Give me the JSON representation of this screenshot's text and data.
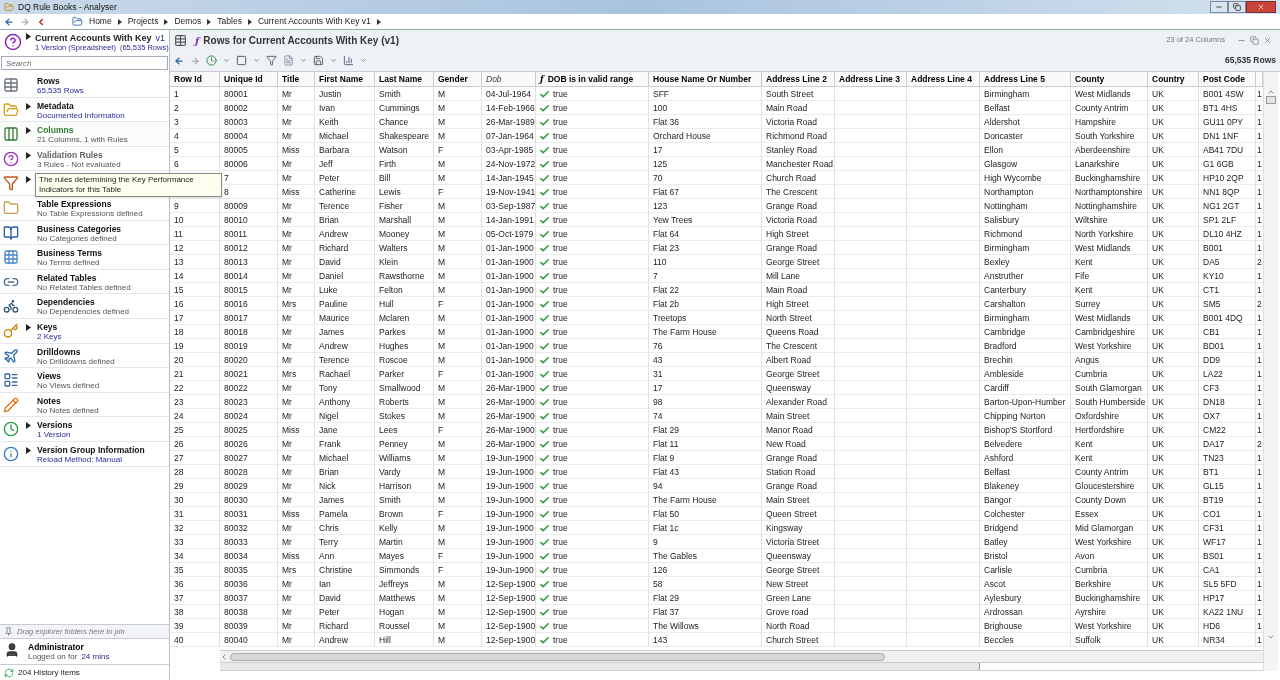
{
  "window": {
    "title": "DQ Rule Books - Analyser"
  },
  "breadcrumbs": [
    "Home",
    "Projects",
    "Demos",
    "Tables",
    "Current Accounts With Key v1"
  ],
  "sidebar": {
    "title": "Current Accounts With Key",
    "version_tag": "v1",
    "subtitle": "1 Version (Spreadsheet)",
    "row_count": "(65,535 Rows)",
    "search": {
      "placeholder": "Search"
    },
    "items": [
      {
        "title": "Rows",
        "sub": "65,535 Rows",
        "has_children": false,
        "hovered": false,
        "dimmed": false,
        "sub_link": true
      },
      {
        "title": "Metadata",
        "sub": "Documented Information",
        "has_children": true,
        "hovered": false,
        "dimmed": false,
        "sub_link": true
      },
      {
        "title": "Columns",
        "sub": "21 Columns, 1 with Rules",
        "has_children": true,
        "hovered": true,
        "dimmed": false,
        "sub_link": false
      },
      {
        "title": "Validation Rules",
        "sub": "3 Rules - Not evaluated",
        "has_children": true,
        "hovered": false,
        "dimmed": true,
        "sub_link": false
      },
      {
        "has_children": true
      },
      {
        "title": "Table Expressions",
        "sub": "No Table Expressions defined",
        "has_children": false,
        "hovered": false,
        "dimmed": false,
        "sub_link": false
      },
      {
        "title": "Business Categories",
        "sub": "No Categories defined",
        "has_children": false,
        "hovered": false,
        "dimmed": false,
        "sub_link": false
      },
      {
        "title": "Business Terms",
        "sub": "No Terms defined",
        "has_children": false,
        "hovered": false,
        "dimmed": false,
        "sub_link": false
      },
      {
        "title": "Related Tables",
        "sub": "No Related Tables defined",
        "has_children": false,
        "hovered": false,
        "dimmed": false,
        "sub_link": false
      },
      {
        "title": "Dependencies",
        "sub": "No Dependencies defined",
        "has_children": false,
        "hovered": false,
        "dimmed": false,
        "sub_link": false
      },
      {
        "title": "Keys",
        "sub": "2 Keys",
        "has_children": true,
        "hovered": false,
        "dimmed": false,
        "sub_link": true
      },
      {
        "title": "Drilldowns",
        "sub": "No Drilldowns defined",
        "has_children": false,
        "hovered": false,
        "dimmed": false,
        "sub_link": false
      },
      {
        "title": "Views",
        "sub": "No Views defined",
        "has_children": false,
        "hovered": false,
        "dimmed": false,
        "sub_link": false
      },
      {
        "title": "Notes",
        "sub": "No Notes defined",
        "has_children": false,
        "hovered": false,
        "dimmed": false,
        "sub_link": false
      },
      {
        "title": "Versions",
        "sub": "1 Version",
        "has_children": true,
        "hovered": false,
        "dimmed": false,
        "sub_link": true
      },
      {
        "title": "Version Group Information",
        "sub": "Reload Method: Manual",
        "has_children": true,
        "hovered": false,
        "dimmed": false,
        "sub_link": true
      }
    ],
    "pin_hint": "Drag explorer folders here to pin",
    "user": {
      "name": "Administrator",
      "status": "Logged on for",
      "duration": "24 mins"
    },
    "history": "204 History items"
  },
  "tooltip": "The rules determining the Key Performance Indicators for this Table",
  "panel": {
    "title_prefix": "ƒ",
    "title": "Rows for Current Accounts With Key (v1)",
    "columns_info": "23 of 24 Columns",
    "rows_info": "65,535 Rows"
  },
  "table": {
    "columns": [
      {
        "label": "Row Id",
        "kind": "data"
      },
      {
        "label": "Unique Id",
        "kind": "data"
      },
      {
        "label": "Title",
        "kind": "data"
      },
      {
        "label": "First Name",
        "kind": "data"
      },
      {
        "label": "Last Name",
        "kind": "data"
      },
      {
        "label": "Gender",
        "kind": "data"
      },
      {
        "label": "Dob",
        "kind": "lookup"
      },
      {
        "label": "DOB is in valid range",
        "kind": "rule",
        "prefix": "ƒ"
      },
      {
        "label": "House Name Or Number",
        "kind": "data"
      },
      {
        "label": "Address Line 2",
        "kind": "data"
      },
      {
        "label": "Address Line 3",
        "kind": "data"
      },
      {
        "label": "Address Line 4",
        "kind": "data"
      },
      {
        "label": "Address Line 5",
        "kind": "data"
      },
      {
        "label": "County",
        "kind": "data"
      },
      {
        "label": "Country",
        "kind": "data"
      },
      {
        "label": "Post Code",
        "kind": "data"
      },
      {
        "kind": "data"
      }
    ],
    "rows": [
      [
        "1",
        "80001",
        "Mr",
        "Justin",
        "Smith",
        "M",
        "04-Jul-1964",
        "true",
        "SFF",
        "South Street",
        null,
        null,
        "Birmingham",
        "West Midlands",
        "UK",
        "B001  4SW",
        "1"
      ],
      [
        "2",
        "80002",
        "Mr",
        "Ivan",
        "Cummings",
        "M",
        "14-Feb-1966",
        "true",
        "100",
        "Main Road",
        null,
        null,
        "Belfast",
        "County Antrim",
        "UK",
        "BT1 4HS",
        "1"
      ],
      [
        "3",
        "80003",
        "Mr",
        "Keith",
        "Chance",
        "M",
        "26-Mar-1989",
        "true",
        "Flat 36",
        "Victoria Road",
        null,
        null,
        "Aldershot",
        "Hampshire",
        "UK",
        "GU11 0PY",
        "1"
      ],
      [
        "4",
        "80004",
        "Mr",
        "Michael",
        "Shakespeare",
        "M",
        "07-Jan-1964",
        "true",
        "Orchard House",
        "Richmond Road",
        null,
        null,
        "Doncaster",
        "South Yorkshire",
        "UK",
        "DN1 1NF",
        "1"
      ],
      [
        "5",
        "80005",
        "Miss",
        "Barbara",
        "Watson",
        "F",
        "03-Apr-1985",
        "true",
        "17",
        "Stanley Road",
        null,
        null,
        "Ellon",
        "Aberdeenshire",
        "UK",
        "AB41 7DU",
        "1"
      ],
      [
        "6",
        "80006",
        "Mr",
        "Jeff",
        "Firth",
        "M",
        "24-Nov-1972",
        "true",
        "125",
        "Manchester Road",
        null,
        null,
        "Glasgow",
        "Lanarkshire",
        "UK",
        "G1 6GB",
        "1"
      ],
      [
        null,
        "7",
        "Mr",
        "Peter",
        "Bill",
        "M",
        "14-Jan-1945",
        "true",
        "70",
        "Church Road",
        null,
        null,
        "High Wycombe",
        "Buckinghamshire",
        "UK",
        "HP10 2QP",
        "1"
      ],
      [
        null,
        "8",
        "Miss",
        "Catherine",
        "Lewis",
        "F",
        "19-Nov-1941",
        "true",
        "Flat 67",
        "The Crescent",
        null,
        null,
        "Northampton",
        "Northamptonshire",
        "UK",
        "NN1 8QP",
        "1"
      ],
      [
        "9",
        "80009",
        "Mr",
        "Terence",
        "Fisher",
        "M",
        "03-Sep-1987",
        "true",
        "123",
        "Grange Road",
        null,
        null,
        "Nottingham",
        "Nottinghamshire",
        "UK",
        "NG1 2GT",
        "1"
      ],
      [
        "10",
        "80010",
        "Mr",
        "Brian",
        "Marshall",
        "M",
        "14-Jan-1991",
        "true",
        "Yew Trees",
        "Victoria Road",
        null,
        null,
        "Salisbury",
        "Wiltshire",
        "UK",
        "SP1 2LF",
        "1"
      ],
      [
        "11",
        "80011",
        "Mr",
        "Andrew",
        "Mooney",
        "M",
        "05-Oct-1979",
        "true",
        "Flat 64",
        "High Street",
        null,
        null,
        "Richmond",
        "North Yorkshire",
        "UK",
        "DL10 4HZ",
        "1"
      ],
      [
        "12",
        "80012",
        "Mr",
        "Richard",
        "Walters",
        "M",
        "01-Jan-1900",
        "true",
        "Flat 23",
        "Grange Road",
        null,
        null,
        "Birmingham",
        "West Midlands",
        "UK",
        "B001",
        "1"
      ],
      [
        "13",
        "80013",
        "Mr",
        "David",
        "Klein",
        "M",
        "01-Jan-1900",
        "true",
        "110",
        "George Street",
        null,
        null,
        "Bexley",
        "Kent",
        "UK",
        "DA5",
        "2"
      ],
      [
        "14",
        "80014",
        "Mr",
        "Daniel",
        "Rawsthorne",
        "M",
        "01-Jan-1900",
        "true",
        "7",
        "Mill Lane",
        null,
        null,
        "Anstruther",
        "Fife",
        "UK",
        "KY10",
        "1"
      ],
      [
        "15",
        "80015",
        "Mr",
        "Luke",
        "Felton",
        "M",
        "01-Jan-1900",
        "true",
        "Flat 22",
        "Main Road",
        null,
        null,
        "Canterbury",
        "Kent",
        "UK",
        "CT1",
        "1"
      ],
      [
        "16",
        "80016",
        "Mrs",
        "Pauline",
        "Hull",
        "F",
        "01-Jan-1900",
        "true",
        "Flat 2b",
        "High Street",
        null,
        null,
        "Carshalton",
        "Surrey",
        "UK",
        "SM5",
        "2"
      ],
      [
        "17",
        "80017",
        "Mr",
        "Maurice",
        "Mclaren",
        "M",
        "01-Jan-1900",
        "true",
        "Treetops",
        "North Street",
        null,
        null,
        "Birmingham",
        "West Midlands",
        "UK",
        "B001  4DQ",
        "1"
      ],
      [
        "18",
        "80018",
        "Mr",
        "James",
        "Parkes",
        "M",
        "01-Jan-1900",
        "true",
        "The Farm House",
        "Queens Road",
        null,
        null,
        "Cambridge",
        "Cambridgeshire",
        "UK",
        "CB1",
        "1"
      ],
      [
        "19",
        "80019",
        "Mr",
        "Andrew",
        "Hughes",
        "M",
        "01-Jan-1900",
        "true",
        "76",
        "The Crescent",
        null,
        null,
        "Bradford",
        "West Yorkshire",
        "UK",
        "BD01",
        "1"
      ],
      [
        "20",
        "80020",
        "Mr",
        "Terence",
        "Roscoe",
        "M",
        "01-Jan-1900",
        "true",
        "43",
        "Albert Road",
        null,
        null,
        "Brechin",
        "Angus",
        "UK",
        "DD9",
        "1"
      ],
      [
        "21",
        "80021",
        "Mrs",
        "Rachael",
        "Parker",
        "F",
        "01-Jan-1900",
        "true",
        "31",
        "George Street",
        null,
        null,
        "Ambleside",
        "Cumbria",
        "UK",
        "LA22",
        "1"
      ],
      [
        "22",
        "80022",
        "Mr",
        "Tony",
        "Smallwood",
        "M",
        "26-Mar-1900",
        "true",
        "17",
        "Queensway",
        null,
        null,
        "Cardiff",
        "South Glamorgan",
        "UK",
        "CF3",
        "1"
      ],
      [
        "23",
        "80023",
        "Mr",
        "Anthony",
        "Roberts",
        "M",
        "26-Mar-1900",
        "true",
        "98",
        "Alexander Road",
        null,
        null,
        "Barton-Upon-Humber",
        "South Humberside",
        "UK",
        "DN18",
        "1"
      ],
      [
        "24",
        "80024",
        "Mr",
        "Nigel",
        "Stokes",
        "M",
        "26-Mar-1900",
        "true",
        "74",
        "Main Street",
        null,
        null,
        "Chipping Norton",
        "Oxfordshire",
        "UK",
        "OX7",
        "1"
      ],
      [
        "25",
        "80025",
        "Miss",
        "Jane",
        "Lees",
        "F",
        "26-Mar-1900",
        "true",
        "Flat 29",
        "Manor Road",
        null,
        null,
        "Bishop'S Stortford",
        "Hertfordshire",
        "UK",
        "CM22",
        "1"
      ],
      [
        "26",
        "80026",
        "Mr",
        "Frank",
        "Penney",
        "M",
        "26-Mar-1900",
        "true",
        "Flat 11",
        "New Road",
        null,
        null,
        "Belvedere",
        "Kent",
        "UK",
        "DA17",
        "2"
      ],
      [
        "27",
        "80027",
        "Mr",
        "Michael",
        "Williams",
        "M",
        "19-Jun-1900",
        "true",
        "Flat 9",
        "Grange Road",
        null,
        null,
        "Ashford",
        "Kent",
        "UK",
        "TN23",
        "1"
      ],
      [
        "28",
        "80028",
        "Mr",
        "Brian",
        "Vardy",
        "M",
        "19-Jun-1900",
        "true",
        "Flat 43",
        "Station Road",
        null,
        null,
        "Belfast",
        "County Antrim",
        "UK",
        "BT1",
        "1"
      ],
      [
        "29",
        "80029",
        "Mr",
        "Nick",
        "Harrison",
        "M",
        "19-Jun-1900",
        "true",
        "94",
        "Grange Road",
        null,
        null,
        "Blakeney",
        "Gloucestershire",
        "UK",
        "GL15",
        "1"
      ],
      [
        "30",
        "80030",
        "Mr",
        "James",
        "Smith",
        "M",
        "19-Jun-1900",
        "true",
        "The Farm House",
        "Main Street",
        null,
        null,
        "Bangor",
        "County Down",
        "UK",
        "BT19",
        "1"
      ],
      [
        "31",
        "80031",
        "Miss",
        "Pamela",
        "Brown",
        "F",
        "19-Jun-1900",
        "true",
        "Flat 50",
        "Queen Street",
        null,
        null,
        "Colchester",
        "Essex",
        "UK",
        "CO1",
        "1"
      ],
      [
        "32",
        "80032",
        "Mr",
        "Chris",
        "Kelly",
        "M",
        "19-Jun-1900",
        "true",
        "Flat 1c",
        "Kingsway",
        null,
        null,
        "Bridgend",
        "Mid Glamorgan",
        "UK",
        "CF31",
        "1"
      ],
      [
        "33",
        "80033",
        "Mr",
        "Terry",
        "Martin",
        "M",
        "19-Jun-1900",
        "true",
        "9",
        "Victoria Street",
        null,
        null,
        "Batley",
        "West Yorkshire",
        "UK",
        "WF17",
        "1"
      ],
      [
        "34",
        "80034",
        "Miss",
        "Ann",
        "Mayes",
        "F",
        "19-Jun-1900",
        "true",
        "The Gables",
        "Queensway",
        null,
        null,
        "Bristol",
        "Avon",
        "UK",
        "BS01",
        "1"
      ],
      [
        "35",
        "80035",
        "Mrs",
        "Christine",
        "Simmonds",
        "F",
        "19-Jun-1900",
        "true",
        "126",
        "George Street",
        null,
        null,
        "Carlisle",
        "Cumbria",
        "UK",
        "CA1",
        "1"
      ],
      [
        "36",
        "80036",
        "Mr",
        "Ian",
        "Jeffreys",
        "M",
        "12-Sep-1900",
        "true",
        "58",
        "New Street",
        null,
        null,
        "Ascot",
        "Berkshire",
        "UK",
        "SL5 5FD",
        "1"
      ],
      [
        "37",
        "80037",
        "Mr",
        "David",
        "Matthews",
        "M",
        "12-Sep-1900",
        "true",
        "Flat 29",
        "Green Lane",
        null,
        null,
        "Aylesbury",
        "Buckinghamshire",
        "UK",
        "HP17",
        "1"
      ],
      [
        "38",
        "80038",
        "Mr",
        "Peter",
        "Hogan",
        "M",
        "12-Sep-1900",
        "true",
        "Flat 37",
        "Grove road",
        null,
        null,
        "Ardrossan",
        "Ayrshire",
        "UK",
        "KA22 1NU",
        "1"
      ],
      [
        "39",
        "80039",
        "Mr",
        "Richard",
        "Roussel",
        "M",
        "12-Sep-1900",
        "true",
        "The Willows",
        "North Road",
        null,
        null,
        "Brighouse",
        "West Yorkshire",
        "UK",
        "HD6",
        "1"
      ],
      [
        "40",
        "80040",
        "Mr",
        "Andrew",
        "Hill",
        "M",
        "12-Sep-1900",
        "true",
        "143",
        "Church Street",
        null,
        null,
        "Beccles",
        "Suffolk",
        "UK",
        "NR34",
        "1"
      ]
    ]
  }
}
